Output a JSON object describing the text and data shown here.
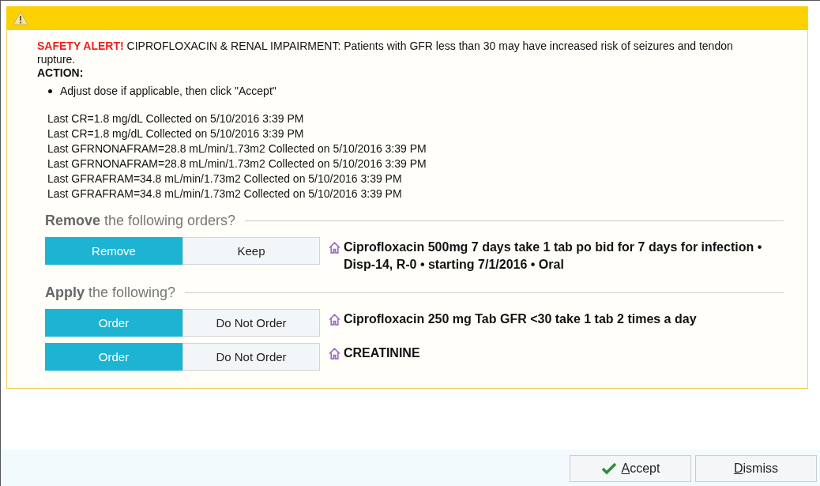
{
  "alert": {
    "label": "SAFETY ALERT!",
    "message": "CIPROFLOXACIN & RENAL IMPAIRMENT: Patients with GFR less than 30 may have increased risk of seizures and tendon rupture.",
    "action_heading": "ACTION:",
    "action_items": [
      "Adjust dose if applicable, then click \"Accept\""
    ]
  },
  "lab_results": [
    "Last CR=1.8 mg/dL Collected on 5/10/2016 3:39 PM",
    "Last CR=1.8 mg/dL Collected on 5/10/2016 3:39 PM",
    "Last GFRNONAFRAM=28.8 mL/min/1.73m2 Collected on 5/10/2016 3:39 PM",
    "Last GFRNONAFRAM=28.8 mL/min/1.73m2 Collected on 5/10/2016 3:39 PM",
    "Last GFRAFRAM=34.8 mL/min/1.73m2 Collected on 5/10/2016 3:39 PM",
    "Last GFRAFRAM=34.8 mL/min/1.73m2 Collected on 5/10/2016 3:39 PM"
  ],
  "sections": [
    {
      "title": "**Remove** the following orders?",
      "orders": [
        {
          "options": [
            {
              "label": "Remove",
              "selected": true
            },
            {
              "label": "Keep",
              "selected": false
            }
          ],
          "description": "Ciprofloxacin 500mg 7 days take 1 tab po bid for 7 days for infection • Disp-14, R-0 • starting 7/1/2016 • Oral"
        }
      ]
    },
    {
      "title": "**Apply** the following?",
      "orders": [
        {
          "options": [
            {
              "label": "Order",
              "selected": true
            },
            {
              "label": "Do Not Order",
              "selected": false
            }
          ],
          "description": "Ciprofloxacin 250 mg Tab GFR <30 take 1 tab 2 times a day"
        },
        {
          "options": [
            {
              "label": "Order",
              "selected": true
            },
            {
              "label": "Do Not Order",
              "selected": false
            }
          ],
          "description": "CREATININE"
        }
      ]
    }
  ],
  "buttons": [
    {
      "label": "Accept",
      "kind": "accept"
    },
    {
      "label": "Dismiss",
      "kind": "dismiss"
    }
  ]
}
